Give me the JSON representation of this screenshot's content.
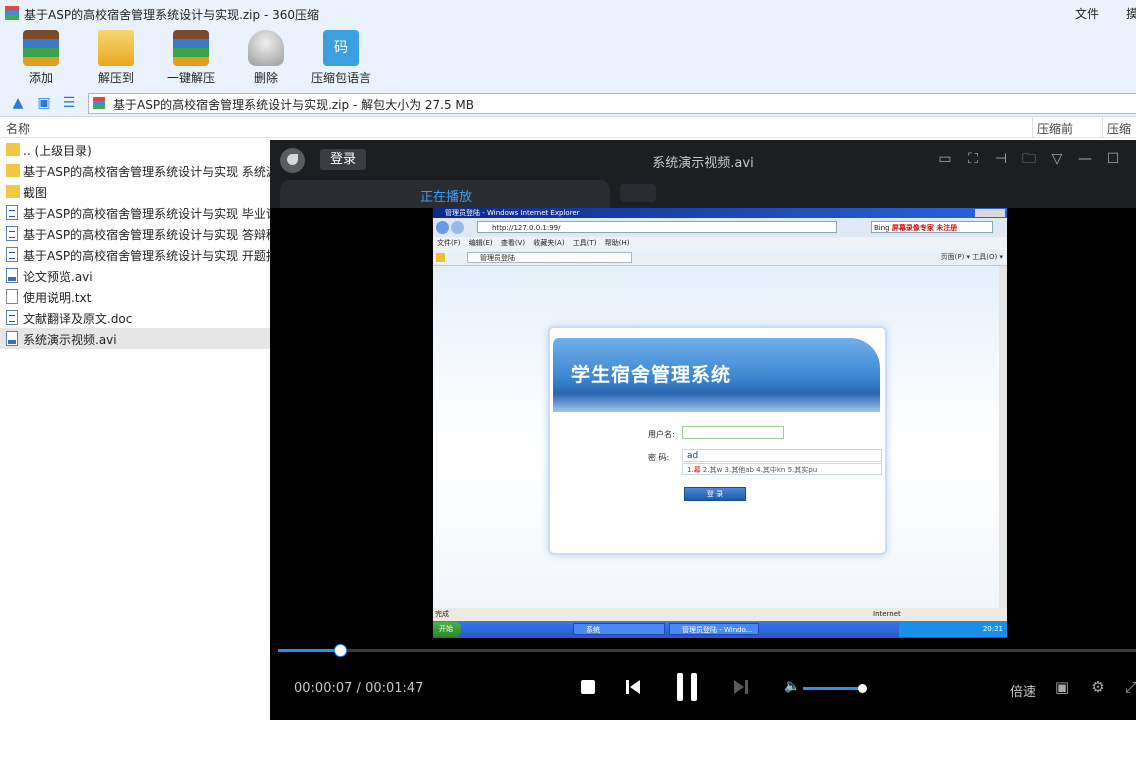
{
  "window": {
    "title": "基于ASP的高校宿舍管理系统设计与实现.zip - 360压缩",
    "menu_file": "文件",
    "menu_more": "摸"
  },
  "toolbar": {
    "items": [
      {
        "label": "添加",
        "icon": "add-archive-icon"
      },
      {
        "label": "解压到",
        "icon": "extract-folder-icon"
      },
      {
        "label": "一键解压",
        "icon": "one-click-extract-icon"
      },
      {
        "label": "删除",
        "icon": "trash-bin-icon"
      },
      {
        "label": "压缩包语言",
        "icon": "language-icon",
        "glyph": "码"
      }
    ]
  },
  "addressbar": {
    "up_glyph": "🡅",
    "path": "基于ASP的高校宿舍管理系统设计与实现.zip - 解包大小为 27.5 MB"
  },
  "columns": {
    "name": "名称",
    "compressed_before": "压缩前",
    "compressed_after": "压缩后"
  },
  "files": [
    {
      "name": ".. (上级目录)",
      "type": "folder"
    },
    {
      "name": "基于ASP的高校宿舍管理系统设计与实现 系统源",
      "type": "folder"
    },
    {
      "name": "截图",
      "type": "folder"
    },
    {
      "name": "基于ASP的高校宿舍管理系统设计与实现 毕业论",
      "type": "doc"
    },
    {
      "name": "基于ASP的高校宿舍管理系统设计与实现 答辩稿",
      "type": "doc"
    },
    {
      "name": "基于ASP的高校宿舍管理系统设计与实现 开题报",
      "type": "doc"
    },
    {
      "name": "论文预览.avi",
      "type": "avi"
    },
    {
      "name": "使用说明.txt",
      "type": "txt"
    },
    {
      "name": "文献翻译及原文.doc",
      "type": "doc"
    },
    {
      "name": "系统演示视频.avi",
      "type": "avi",
      "selected": true
    }
  ],
  "player": {
    "login_label": "登录",
    "title": "系统演示视频.avi",
    "tab_label": "正在播放",
    "current_time": "00:00:07",
    "separator": "/",
    "total_time": "00:01:47",
    "progress_fraction": 0.072,
    "volume_fraction": 0.95,
    "speed_label": "倍速",
    "accent_color": "#2a8ef0"
  },
  "video": {
    "ie_title": "管理员登陆 - Windows Internet Explorer",
    "ie_url": "http://127.0.0.1:99/",
    "ie_search": "Bing",
    "ie_search_ad": "屏幕录像专家 未注册",
    "ie_menu": "文件(F) 编辑(E) 查看(V) 收藏夹(A) 工具(T) 帮助(H)",
    "ie_tab": "管理员登陆",
    "ie_tools": "页面(P) ▾ 工具(O) ▾",
    "system_title": "学生宿舍管理系统",
    "username_label": "用户名:",
    "password_label": "密  码:",
    "password_value": "ad",
    "ime_candidates_first": "1.幕",
    "ime_candidates_rest": " 2.其w 3.其他ab 4.其中kn 5.其实pu",
    "login_button": "登 录",
    "status_left": "完成",
    "status_zone": "Internet",
    "start_label": "开始",
    "task1": "系统",
    "task2": "管理员登陆 - Windo...",
    "clock": "20:21"
  }
}
